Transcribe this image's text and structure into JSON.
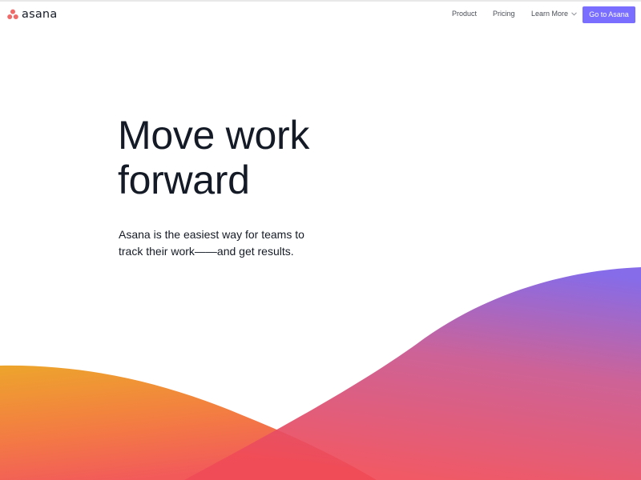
{
  "brand": {
    "name": "asana",
    "logo_icon": "asana-dots-icon",
    "logo_color": "#f06a6a"
  },
  "nav": {
    "items": [
      {
        "label": "Product"
      },
      {
        "label": "Pricing"
      },
      {
        "label": "Learn More",
        "icon": "chevron-down-icon"
      }
    ],
    "cta_label": "Go to Asana",
    "cta_color": "#796eff"
  },
  "hero": {
    "headline_lines": [
      "Move work",
      "forward"
    ],
    "subtext_lines": [
      "Asana is the easiest way for teams to",
      "track their work——and get results."
    ]
  },
  "colors": {
    "wave_left_top": "#eda52c",
    "wave_left_bottom": "#f25a5a",
    "wave_right_top": "#7c5fe6",
    "wave_right_mid": "#c9558e",
    "wave_right_bottom": "#f04b57"
  }
}
